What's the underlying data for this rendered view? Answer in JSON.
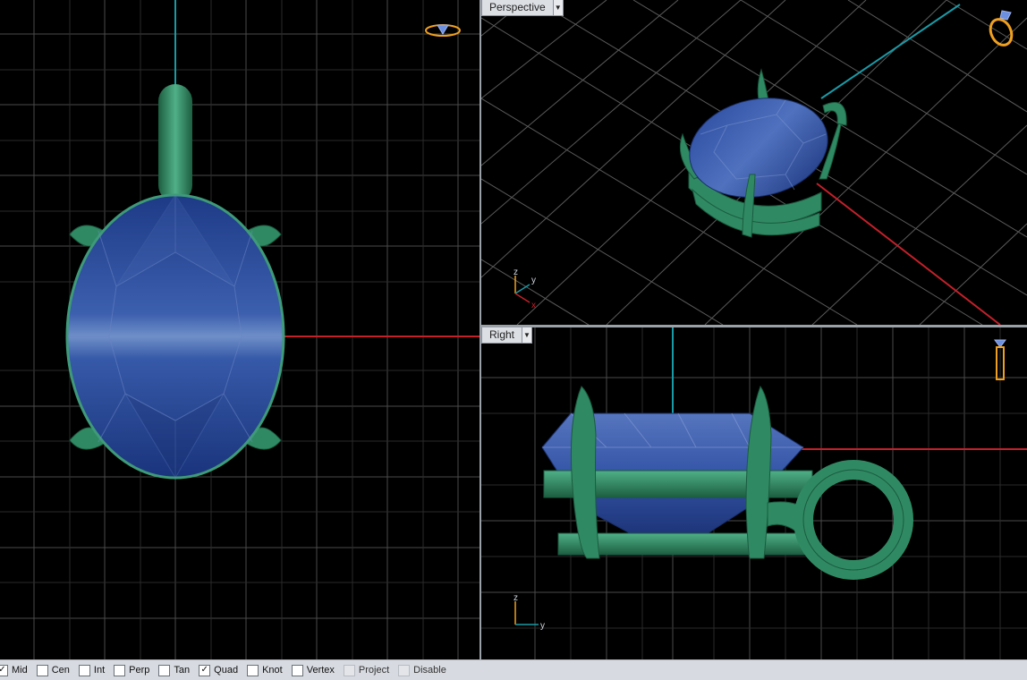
{
  "viewports": {
    "top_left": {
      "name": ""
    },
    "perspective": {
      "name": "Perspective",
      "dropdown_icon": "chevron-down-icon"
    },
    "right": {
      "name": "Right",
      "dropdown_icon": "chevron-down-icon"
    }
  },
  "axes": {
    "perspective": {
      "x": "x",
      "y": "y",
      "z": "z"
    },
    "right": {
      "y": "y",
      "z": "z"
    }
  },
  "status_bar": {
    "osnaps": [
      {
        "label": "Mid",
        "checked": true,
        "enabled": true
      },
      {
        "label": "Cen",
        "checked": false,
        "enabled": true
      },
      {
        "label": "Int",
        "checked": false,
        "enabled": true
      },
      {
        "label": "Perp",
        "checked": false,
        "enabled": true
      },
      {
        "label": "Tan",
        "checked": false,
        "enabled": true
      },
      {
        "label": "Quad",
        "checked": true,
        "enabled": true
      },
      {
        "label": "Knot",
        "checked": false,
        "enabled": true
      },
      {
        "label": "Vertex",
        "checked": false,
        "enabled": true
      },
      {
        "label": "Project",
        "checked": false,
        "enabled": false
      },
      {
        "label": "Disable",
        "checked": false,
        "enabled": false
      }
    ]
  },
  "colors": {
    "background": "#000000",
    "grid": "#5a5a5a",
    "x_axis": "#c4202a",
    "y_axis": "#1a9aa6",
    "gem": "#2b4a9a",
    "metal": "#2f8a63",
    "nav_icon": "#f0a020"
  }
}
